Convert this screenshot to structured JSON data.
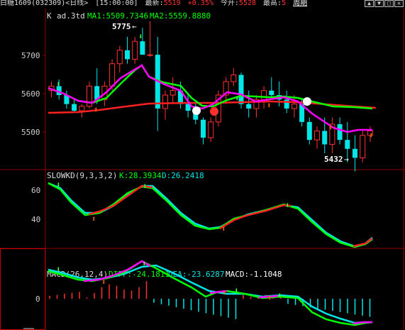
{
  "topbar": {
    "symbol": "白糖1609(032309)<日线>",
    "time": "[15:00:00]",
    "latest_label": "最新:",
    "latest_value": "5519",
    "change": "+0.35%",
    "open_label": "今开:",
    "open_value": "5528",
    "high_label": "最高:",
    "high_value": "5",
    "cycle_label": "周期"
  },
  "main_panel": {
    "label_k": "K",
    "label_indicator": "ad.3td",
    "ma1": "MA1:5509.7346",
    "ma2": "MA2:5559.8880",
    "high_annotation": "5775",
    "low_annotation": "5432",
    "y_ticks": [
      "5700",
      "5600",
      "5500"
    ]
  },
  "kd_panel": {
    "title": "SLOWKD(9,3,3,2)",
    "k_value": "K:28.3934",
    "d_value": "D:26.2418",
    "y_ticks": [
      "60",
      "40"
    ]
  },
  "macd_panel": {
    "title": "MACD(26,12,4)",
    "diff_value": "DIFF:-24.1811",
    "dea_value": "DEA:-23.6287",
    "macd_value": "MACD:-1.1048",
    "y_ticks": [
      "0"
    ]
  },
  "colors": {
    "up": "#ff3030",
    "down": "#00e5e5",
    "ma1": "#ff00ff",
    "ma2": "#00ff00",
    "ma_long": "#ff2020",
    "grid": "#8b0000"
  },
  "chart_data": {
    "type": "candlestick",
    "candles": [
      [
        5620,
        5640,
        5605,
        5630
      ],
      [
        5630,
        5645,
        5600,
        5610
      ],
      [
        5610,
        5620,
        5580,
        5590
      ],
      [
        5590,
        5600,
        5570,
        5575
      ],
      [
        5575,
        5590,
        5560,
        5585
      ],
      [
        5585,
        5640,
        5580,
        5630
      ],
      [
        5630,
        5670,
        5590,
        5600
      ],
      [
        5600,
        5640,
        5585,
        5630
      ],
      [
        5630,
        5690,
        5620,
        5680
      ],
      [
        5680,
        5720,
        5660,
        5710
      ],
      [
        5710,
        5740,
        5680,
        5690
      ],
      [
        5690,
        5740,
        5680,
        5730
      ],
      [
        5730,
        5760,
        5700,
        5700
      ],
      [
        5700,
        5775,
        5695,
        5700
      ],
      [
        5700,
        5740,
        5530,
        5580
      ],
      [
        5580,
        5620,
        5555,
        5610
      ],
      [
        5610,
        5650,
        5590,
        5620
      ],
      [
        5620,
        5640,
        5580,
        5590
      ],
      [
        5590,
        5610,
        5560,
        5575
      ],
      [
        5575,
        5590,
        5545,
        5555
      ],
      [
        5555,
        5560,
        5500,
        5515
      ],
      [
        5515,
        5560,
        5505,
        5550
      ],
      [
        5550,
        5620,
        5540,
        5610
      ],
      [
        5610,
        5650,
        5590,
        5640
      ],
      [
        5640,
        5670,
        5630,
        5655
      ],
      [
        5655,
        5660,
        5580,
        5590
      ],
      [
        5590,
        5620,
        5560,
        5580
      ],
      [
        5580,
        5610,
        5560,
        5600
      ],
      [
        5600,
        5630,
        5580,
        5620
      ],
      [
        5620,
        5650,
        5600,
        5610
      ],
      [
        5610,
        5640,
        5585,
        5600
      ],
      [
        5600,
        5620,
        5570,
        5580
      ],
      [
        5580,
        5610,
        5560,
        5590
      ],
      [
        5590,
        5600,
        5540,
        5550
      ],
      [
        5550,
        5560,
        5500,
        5510
      ],
      [
        5510,
        5540,
        5490,
        5530
      ],
      [
        5530,
        5560,
        5480,
        5500
      ],
      [
        5500,
        5560,
        5480,
        5545
      ],
      [
        5545,
        5560,
        5500,
        5510
      ],
      [
        5510,
        5550,
        5460,
        5490
      ],
      [
        5490,
        5520,
        5440,
        5470
      ],
      [
        5470,
        5530,
        5460,
        5520
      ],
      [
        5520,
        5540,
        5505,
        5530
      ]
    ],
    "ylim": [
      5450,
      5800
    ]
  }
}
